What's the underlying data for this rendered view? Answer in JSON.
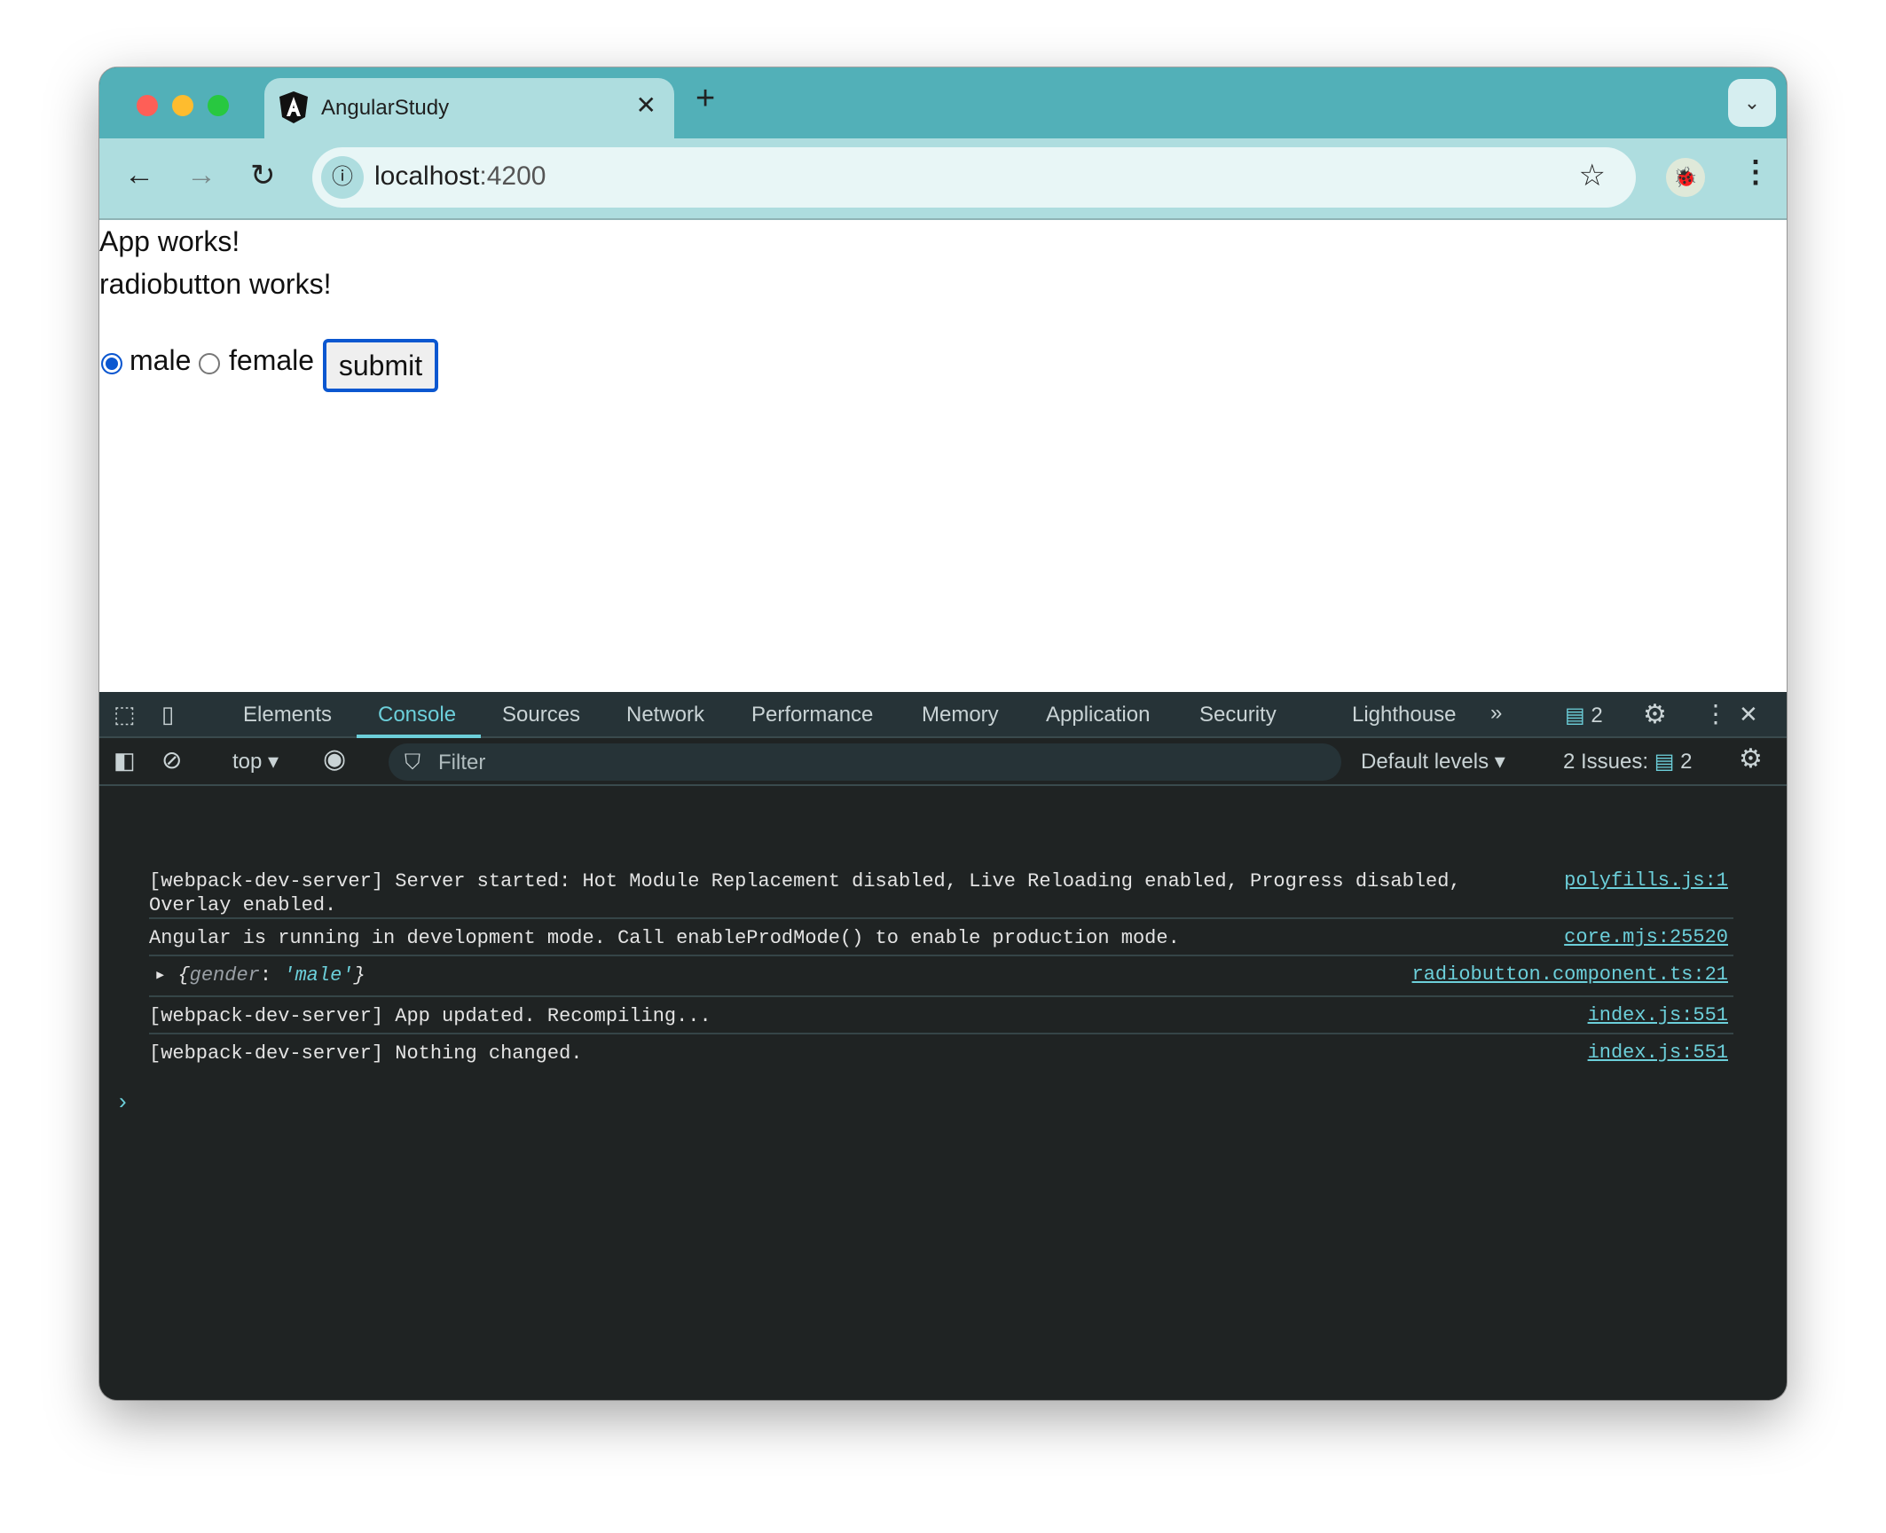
{
  "browser": {
    "tab_title": "AngularStudy",
    "url_host": "localhost",
    "url_port": ":4200"
  },
  "page": {
    "line1": "App works!",
    "line2": "radiobutton works!",
    "options": [
      "male",
      "female"
    ],
    "selected": "male",
    "submit_label": "submit"
  },
  "devtools": {
    "tabs": [
      "Elements",
      "Console",
      "Sources",
      "Network",
      "Performance",
      "Memory",
      "Application",
      "Security",
      "Lighthouse"
    ],
    "active_tab": "Console",
    "messages_count": "2",
    "context": "top",
    "filter_placeholder": "Filter",
    "levels": "Default levels",
    "issues_label": "2 Issues:",
    "issues_count": "2",
    "logs": [
      {
        "text": "[webpack-dev-server] Server started: Hot Module Replacement disabled, Live Reloading enabled, Progress disabled,\nOverlay enabled.",
        "source": "polyfills.js:1"
      },
      {
        "text": "Angular is running in development mode. Call enableProdMode() to enable production mode.",
        "source": "core.mjs:25520"
      },
      {
        "key": "gender",
        "value": "'male'",
        "source": "radiobutton.component.ts:21"
      },
      {
        "text": "[webpack-dev-server] App updated. Recompiling...",
        "source": "index.js:551"
      },
      {
        "text": "[webpack-dev-server] Nothing changed.",
        "source": "index.js:551"
      }
    ]
  }
}
